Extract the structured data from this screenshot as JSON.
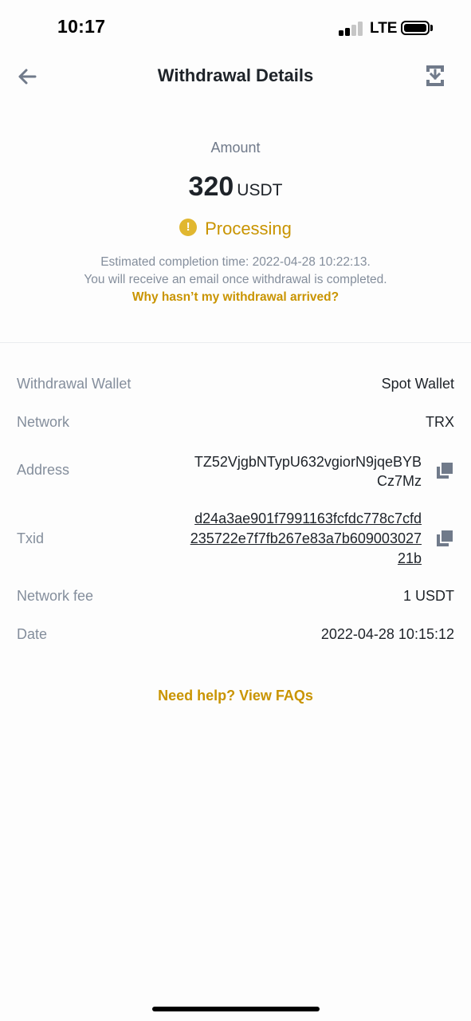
{
  "status_bar": {
    "time": "10:17",
    "network": "LTE"
  },
  "header": {
    "title": "Withdrawal Details",
    "back_icon": "arrow-left-icon",
    "share_icon": "download-share-icon"
  },
  "summary": {
    "amount_label": "Amount",
    "amount_value": "320",
    "amount_unit": "USDT",
    "status_icon": "!",
    "status_text": "Processing",
    "estimate_line1": "Estimated completion time: 2022-04-28 10:22:13.",
    "estimate_line2": "You will receive an email once withdrawal is completed.",
    "why_link": "Why hasn’t my withdrawal arrived?"
  },
  "details": {
    "wallet_label": "Withdrawal Wallet",
    "wallet_value": "Spot Wallet",
    "network_label": "Network",
    "network_value": "TRX",
    "address_label": "Address",
    "address_line1": "TZ52VjgbNTypU632vgiorN9jqeBYB",
    "address_line2": "Cz7Mz",
    "txid_label": "Txid",
    "txid_line1": "d24a3ae901f7991163fcfdc778c7cfd",
    "txid_line2": "235722e7f7fb267e83a7b609003027",
    "txid_line3": "21b",
    "fee_label": "Network fee",
    "fee_value": "1 USDT",
    "date_label": "Date",
    "date_value": "2022-04-28 10:15:12"
  },
  "help_link": "Need help? View FAQs",
  "colors": {
    "accent": "#c99400",
    "status_icon_bg": "#e1b730",
    "label_gray": "#848e9c",
    "text_dark": "#1e2329"
  }
}
